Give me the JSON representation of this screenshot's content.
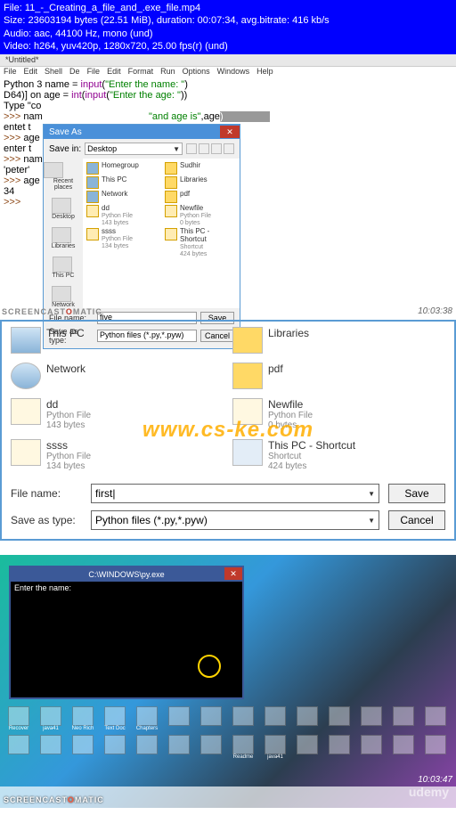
{
  "header": {
    "file": "File: 11_-_Creating_a_file_and_.exe_file.mp4",
    "size": "Size: 23603194 bytes (22.51 MiB), duration: 00:07:34, avg.bitrate: 416 kb/s",
    "audio": "Audio: aac, 44100 Hz, mono (und)",
    "video": "Video: h264, yuv420p, 1280x720, 25.00 fps(r) (und)"
  },
  "idle": {
    "title": "*Untitled*",
    "menus": [
      "File",
      "Edit",
      "Shell",
      "De",
      "File",
      "Edit",
      "Format",
      "Run",
      "Options",
      "Windows",
      "Help"
    ],
    "code": {
      "l1a": "Python 3 ",
      "l1b": "name = ",
      "l1c": "input",
      "l1d": "(",
      "l1e": "\"Enter the name: \"",
      "l1f": ")",
      "l2a": "D64)] on ",
      "l2b": "age = ",
      "l2c": "int",
      "l2d": "(",
      "l2e": "input",
      "l2f": "(",
      "l2g": "\"Enter the age: \"",
      "l2h": "))",
      "l3": "Type \"co",
      "l4a": ">>> ",
      "l4b": "nam",
      "l4c": "\"and age is\"",
      "l4d": ",age",
      "l5": "entet t",
      "l6a": ">>> ",
      "l6b": "age",
      "l7": "enter t",
      "l8a": ">>> ",
      "l8b": "nam",
      "l9": "'peter'",
      "l10a": ">>> ",
      "l10b": "age",
      "l11": "34",
      "l12": ">>> "
    }
  },
  "saveas": {
    "title": "Save As",
    "savein": "Save in:",
    "saveinval": "Desktop",
    "left": [
      "Recent places",
      "Desktop",
      "Libraries",
      "This PC",
      "Network"
    ],
    "files": {
      "c1": [
        {
          "n": "Homegroup",
          "s": ""
        },
        {
          "n": "This PC",
          "s": ""
        },
        {
          "n": "Network",
          "s": ""
        },
        {
          "n": "dd",
          "s": "Python File",
          "s2": "143 bytes"
        },
        {
          "n": "ssss",
          "s": "Python File",
          "s2": "134 bytes"
        }
      ],
      "c2": [
        {
          "n": "Sudhir",
          "s": ""
        },
        {
          "n": "Libraries",
          "s": ""
        },
        {
          "n": "pdf",
          "s": ""
        },
        {
          "n": "Newfile",
          "s": "Python File",
          "s2": "0 bytes"
        },
        {
          "n": "This PC - Shortcut",
          "s": "Shortcut",
          "s2": "424 bytes"
        }
      ]
    },
    "fname_label": "File name:",
    "ftype_label": "Save as type:",
    "fname": "five",
    "ftype": "Python files (*.py,*.pyw)",
    "save": "Save",
    "cancel": "Cancel"
  },
  "wm": "SCREENCAST O MATIC",
  "ts1": "10:03:38",
  "enlarged": {
    "f": [
      {
        "n": "This PC",
        "s": "",
        "t": "pc"
      },
      {
        "n": "Libraries",
        "s": "",
        "t": "fold"
      },
      {
        "n": "Network",
        "s": "",
        "t": "net"
      },
      {
        "n": "pdf",
        "s": "",
        "t": "fold"
      },
      {
        "n": "dd",
        "s": "Python File",
        "s2": "143 bytes",
        "t": "py"
      },
      {
        "n": "Newfile",
        "s": "Python File",
        "s2": "0 bytes",
        "t": "py"
      },
      {
        "n": "ssss",
        "s": "Python File",
        "s2": "134 bytes",
        "t": "py"
      },
      {
        "n": "This PC - Shortcut",
        "s": "Shortcut",
        "s2": "424 bytes",
        "t": "short"
      }
    ],
    "fname_label": "File name:",
    "ftype_label": "Save as type:",
    "fname": "first|",
    "ftype": "Python files (*.py,*.pyw)",
    "save": "Save",
    "cancel": "Cancel",
    "big_wm": "www.cs-ke.com"
  },
  "cmd": {
    "title": "C:\\WINDOWS\\py.exe",
    "line": "Enter the name:"
  },
  "d_icons": [
    "Recover",
    "java41",
    "Neo Rich",
    "Text Doc",
    "Chapters",
    "",
    "",
    "",
    "",
    "",
    "",
    "",
    "",
    "",
    "",
    "",
    "",
    "",
    "",
    "",
    "",
    "Readme",
    "java41",
    "",
    "",
    "",
    "",
    "",
    "",
    "",
    "",
    "",
    "",
    "",
    "",
    "",
    "",
    "",
    "",
    "",
    "",
    ""
  ],
  "ts2": "10:03:47",
  "udemy": "udemy"
}
